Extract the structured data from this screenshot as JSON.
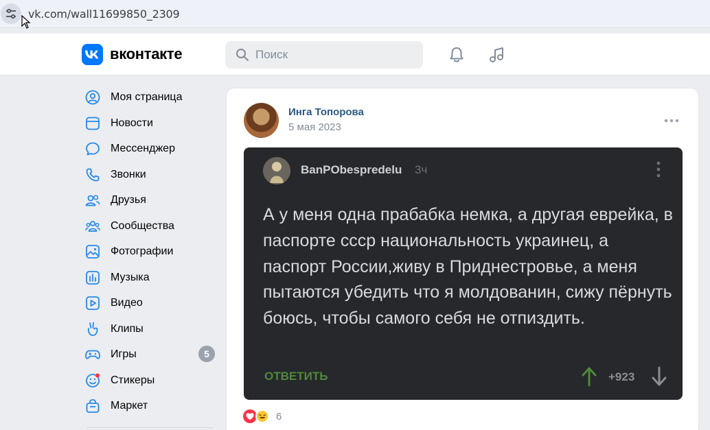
{
  "browser": {
    "url": "vk.com/wall11699850_2309"
  },
  "header": {
    "brand": "вконтакте",
    "search_placeholder": "Поиск"
  },
  "nav": {
    "items": [
      {
        "label": "Моя страница",
        "icon": "profile-icon"
      },
      {
        "label": "Новости",
        "icon": "news-icon"
      },
      {
        "label": "Мессенджер",
        "icon": "messenger-icon"
      },
      {
        "label": "Звонки",
        "icon": "phone-icon"
      },
      {
        "label": "Друзья",
        "icon": "friends-icon"
      },
      {
        "label": "Сообщества",
        "icon": "communities-icon"
      },
      {
        "label": "Фотографии",
        "icon": "photos-icon"
      },
      {
        "label": "Музыка",
        "icon": "music-icon"
      },
      {
        "label": "Видео",
        "icon": "video-icon"
      },
      {
        "label": "Клипы",
        "icon": "clips-icon"
      },
      {
        "label": "Игры",
        "icon": "games-icon",
        "badge": "5"
      },
      {
        "label": "Стикеры",
        "icon": "stickers-icon"
      },
      {
        "label": "Маркет",
        "icon": "market-icon"
      }
    ]
  },
  "post": {
    "author": "Инга Топорова",
    "date": "5 мая 2023",
    "embed": {
      "username": "BanPObespredelu",
      "time": "3ч",
      "text": "А у меня одна прабабка немка, а другая еврейка, в паспорте ссср национальность украинец, а паспорт России,живу в Приднестровье, а меня пытаются убедить что я молдованин, сижу пёрнуть боюсь, чтобы самого себя не отпиздить.",
      "reply_label": "ОТВЕТИТЬ",
      "score": "+923"
    },
    "reactions_count": "6"
  },
  "colors": {
    "accent": "#0077ff",
    "link": "#2a5885",
    "nav_icon": "#2688eb",
    "embed_bg": "#26282b",
    "reply_green": "#4f8a3a"
  }
}
